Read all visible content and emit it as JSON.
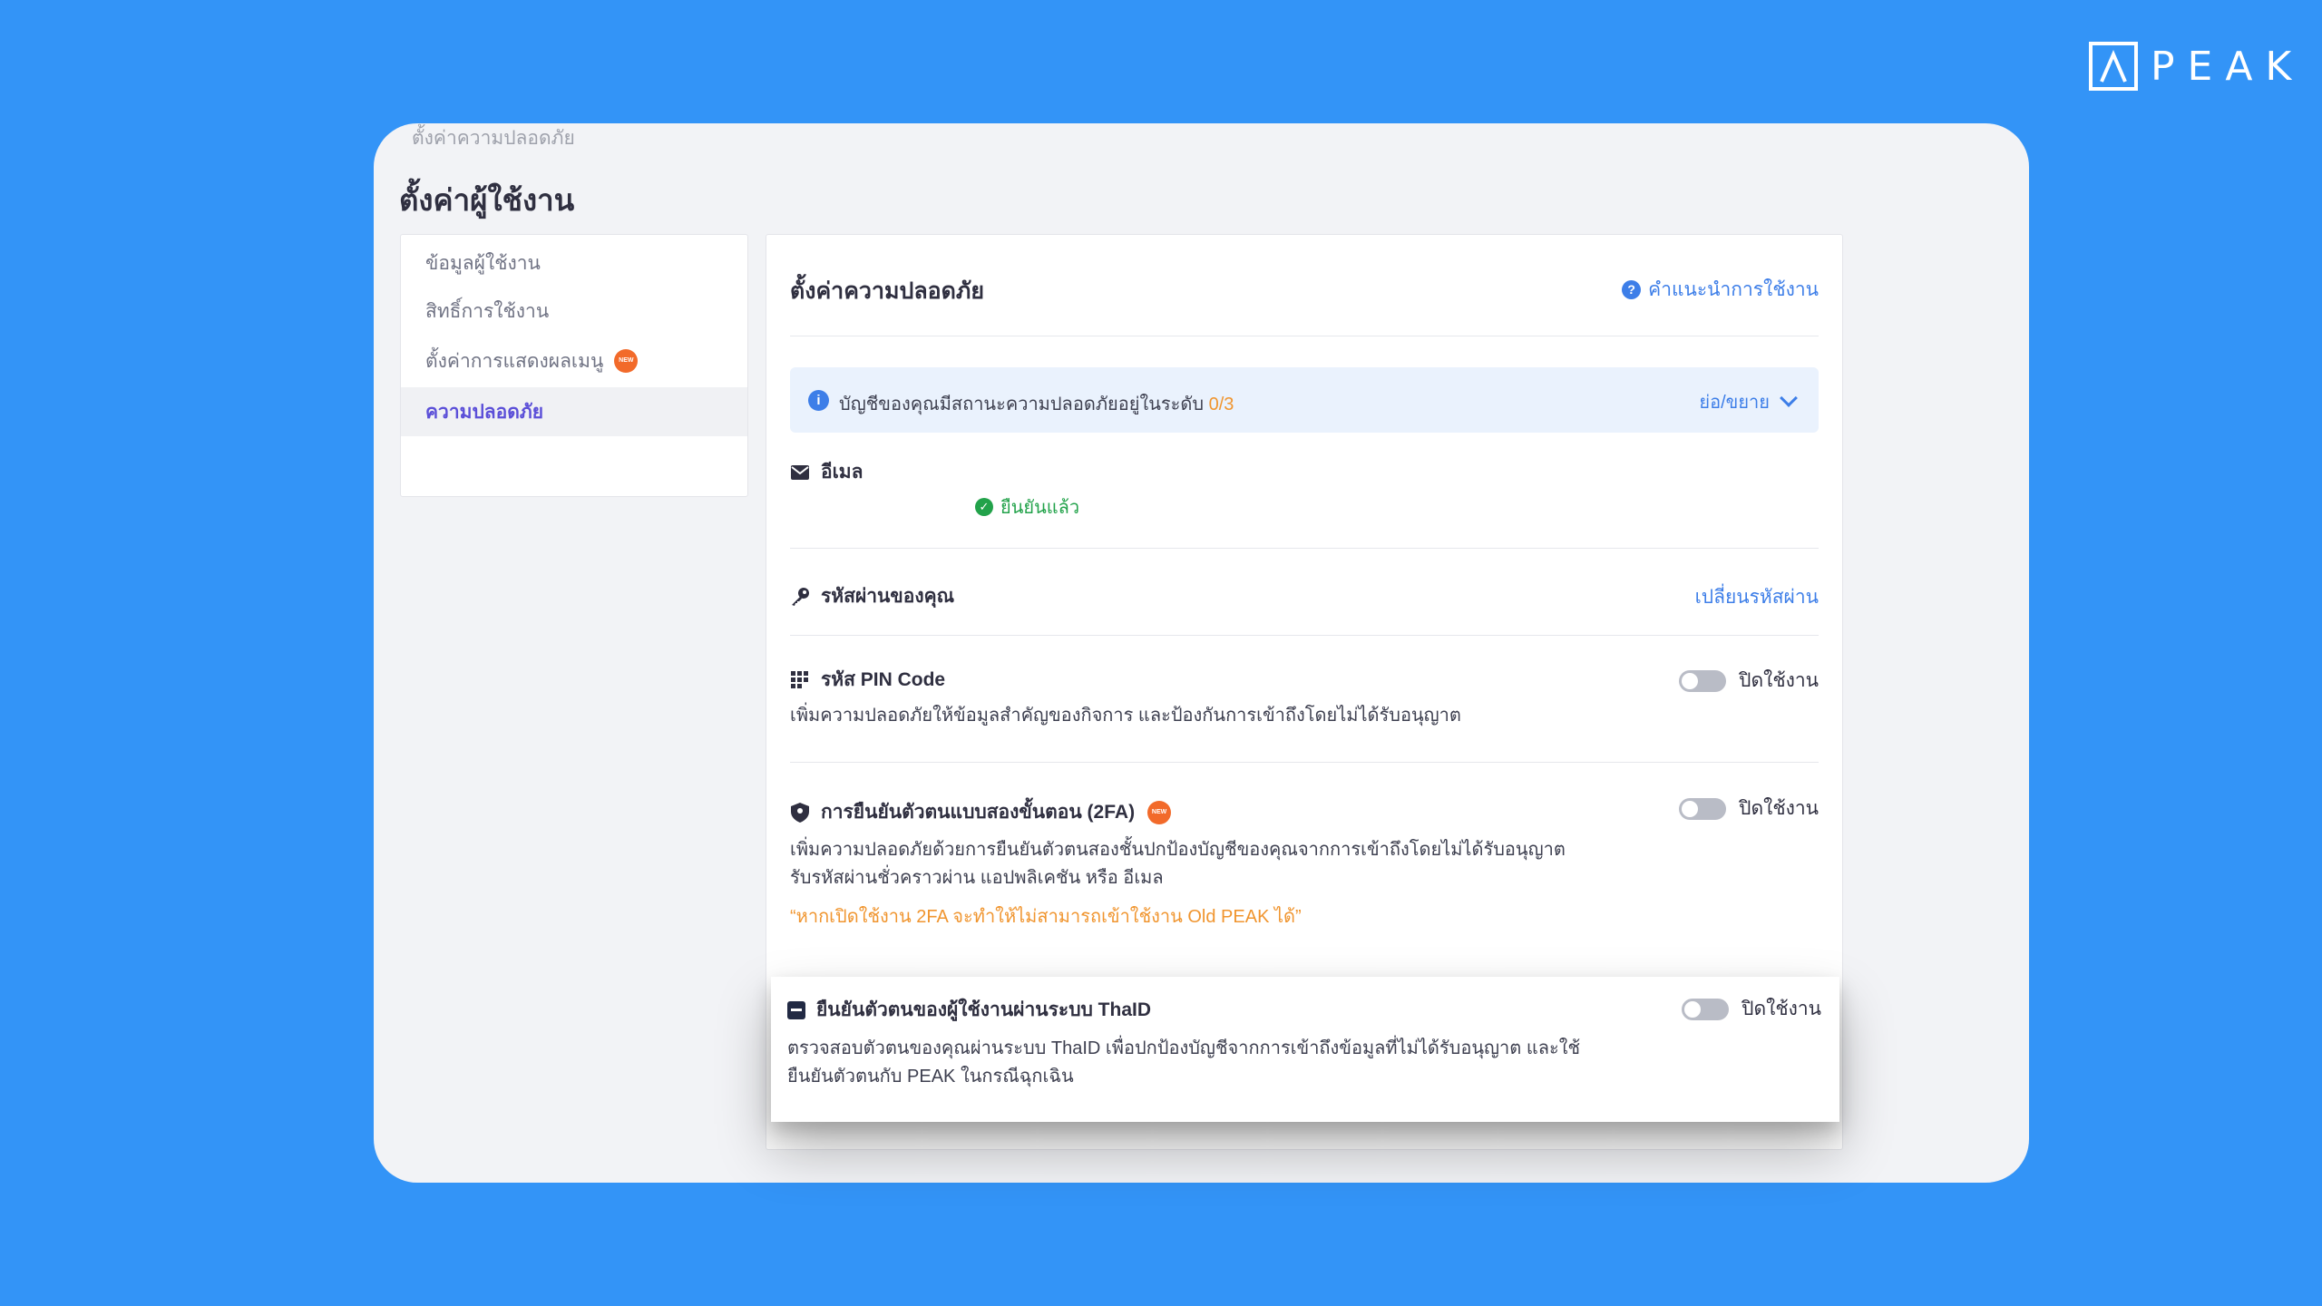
{
  "brand": {
    "logo_text": "PEAK"
  },
  "breadcrumb": "ตั้งค่าความปลอดภัย",
  "page_title": "ตั้งค่าผู้ใช้งาน",
  "sidebar": {
    "items": [
      {
        "label": "ข้อมูลผู้ใช้งาน",
        "active": false
      },
      {
        "label": "สิทธิ์การใช้งาน",
        "active": false
      },
      {
        "label": "ตั้งค่าการแสดงผลเมนู",
        "active": false,
        "badge": "NEW"
      },
      {
        "label": "ความปลอดภัย",
        "active": true
      }
    ]
  },
  "main": {
    "title": "ตั้งค่าความปลอดภัย",
    "help_link": "คำแนะนำการใช้งาน",
    "banner": {
      "text": "บัญชีของคุณมีสถานะความปลอดภัยอยู่ในระดับ",
      "level": "0/3",
      "toggle_label": "ย่อ/ขยาย"
    },
    "email": {
      "title": "อีเมล",
      "status": "ยืนยันแล้ว"
    },
    "password": {
      "title": "รหัสผ่านของคุณ",
      "action": "เปลี่ยนรหัสผ่าน"
    },
    "pin": {
      "title": "รหัส PIN Code",
      "toggle_label": "ปิดใช้งาน",
      "description": "เพิ่มความปลอดภัยให้ข้อมูลสำคัญของกิจการ และป้องกันการเข้าถึงโดยไม่ได้รับอนุญาต"
    },
    "twofa": {
      "title": "การยืนยันตัวตนแบบสองขั้นตอน (2FA)",
      "badge": "NEW",
      "toggle_label": "ปิดใช้งาน",
      "description_line1": "เพิ่มความปลอดภัยด้วยการยืนยันตัวตนสองชั้นปกป้องบัญชีของคุณจากการเข้าถึงโดยไม่ได้รับอนุญาต",
      "description_line2": "รับรหัสผ่านชั่วคราวผ่าน แอปพลิเคชัน หรือ อีเมล",
      "warning": "“หากเปิดใช้งาน 2FA จะทำให้ไม่สามารถเข้าใช้งาน Old PEAK ได้”"
    },
    "thaid": {
      "title": "ยืนยันตัวตนของผู้ใช้งานผ่านระบบ ThaID",
      "toggle_label": "ปิดใช้งาน",
      "description_line1": "ตรวจสอบตัวตนของคุณผ่านระบบ ThaID เพื่อปกป้องบัญชีจากการเข้าถึงข้อมูลที่ไม่ได้รับอนุญาต และใช้",
      "description_line2": "ยืนยันตัวตนกับ PEAK ในกรณีฉุกเฉิน"
    }
  },
  "colors": {
    "background": "#3394f7",
    "accent": "#3d7ee8",
    "active_menu": "#5b4fd8",
    "warning": "#f0952f",
    "success": "#22a24a",
    "badge": "#f26a2a"
  }
}
